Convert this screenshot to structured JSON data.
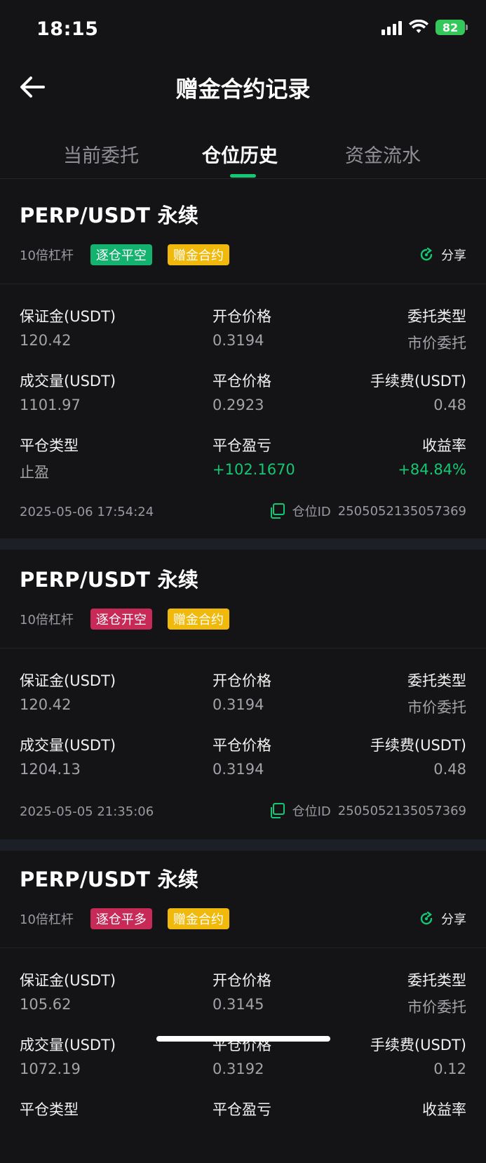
{
  "status_bar": {
    "time": "18:15",
    "battery": "82"
  },
  "header": {
    "title": "赠金合约记录"
  },
  "tabs": [
    {
      "label": "当前委托",
      "active": false
    },
    {
      "label": "仓位历史",
      "active": true
    },
    {
      "label": "资金流水",
      "active": false
    }
  ],
  "labels": {
    "margin": "保证金(USDT)",
    "open_price": "开仓价格",
    "order_type": "委托类型",
    "volume": "成交量(USDT)",
    "close_price": "平仓价格",
    "fee": "手续费(USDT)",
    "close_type": "平仓类型",
    "pnl": "平仓盈亏",
    "roi": "收益率",
    "share": "分享",
    "position_id_prefix": "仓位ID"
  },
  "records": [
    {
      "pair": "PERP/USDT 永续",
      "leverage": "10倍杠杆",
      "side_tag": "逐仓平空",
      "side_color": "#13b26e",
      "bonus_tag": "赠金合约",
      "margin": "120.42",
      "open_price": "0.3194",
      "order_type": "市价委托",
      "volume": "1101.97",
      "close_price": "0.2923",
      "fee": "0.48",
      "close_type": "止盈",
      "pnl": "+102.1670",
      "roi": "+84.84%",
      "time": "2025-05-06 17:54:24",
      "position_id": "2505052135057369"
    },
    {
      "pair": "PERP/USDT 永续",
      "leverage": "10倍杠杆",
      "side_tag": "逐仓开空",
      "side_color": "#c82a58",
      "bonus_tag": "赠金合约",
      "margin": "120.42",
      "open_price": "0.3194",
      "order_type": "市价委托",
      "volume": "1204.13",
      "close_price": "0.3194",
      "fee": "0.48",
      "time": "2025-05-05 21:35:06",
      "position_id": "2505052135057369"
    },
    {
      "pair": "PERP/USDT 永续",
      "leverage": "10倍杠杆",
      "side_tag": "逐仓平多",
      "side_color": "#c82a58",
      "bonus_tag": "赠金合约",
      "margin": "105.62",
      "open_price": "0.3145",
      "order_type": "市价委托",
      "volume": "1072.19",
      "close_price": "0.3192",
      "fee": "0.12"
    }
  ],
  "colors": {
    "accent_green": "#13c774",
    "bonus_gold": "#f0b90b",
    "background": "#141416"
  }
}
